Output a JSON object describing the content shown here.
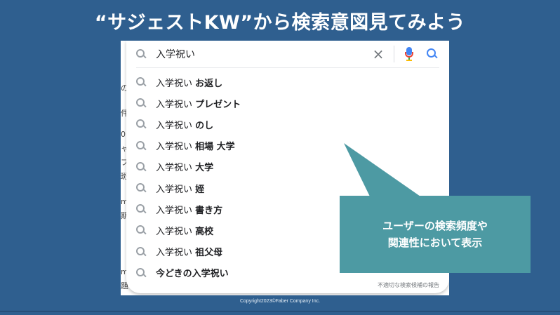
{
  "slide": {
    "title": "“サジェストKW”から検索意図見てみよう",
    "copyright": "Copyright2023©Faber Company Inc."
  },
  "background_page": {
    "edge_fragments": [
      "の",
      "件",
      "0(",
      "ャ",
      "フ",
      "斑",
      "m",
      "期",
      "m",
      "題"
    ]
  },
  "search": {
    "query": "入学祝い",
    "clear_icon": "close-icon",
    "mic_icon": "mic-icon",
    "search_icon": "search-icon",
    "suggestions": [
      {
        "prefix": "入学祝い ",
        "suffix": "お返し"
      },
      {
        "prefix": "入学祝い ",
        "suffix": "プレゼント"
      },
      {
        "prefix": "入学祝い ",
        "suffix": "のし"
      },
      {
        "prefix": "入学祝い ",
        "suffix": "相場 大学"
      },
      {
        "prefix": "入学祝い ",
        "suffix": "大学"
      },
      {
        "prefix": "入学祝い ",
        "suffix": "姪"
      },
      {
        "prefix": "入学祝い ",
        "suffix": "書き方"
      },
      {
        "prefix": "入学祝い ",
        "suffix": "高校"
      },
      {
        "prefix": "入学祝い ",
        "suffix": "祖父母"
      },
      {
        "prefix": "",
        "suffix": "今どきの入学祝い"
      }
    ],
    "report_link": "不適切な検索候補の報告"
  },
  "callout": {
    "line1": "ユーザーの検索頻度や",
    "line2": "関連性において表示",
    "color": "#4d9aa3"
  },
  "colors": {
    "slide_bg": "#2f5f8f",
    "accent_blue": "#4285f4",
    "mic_red": "#ea4335"
  }
}
